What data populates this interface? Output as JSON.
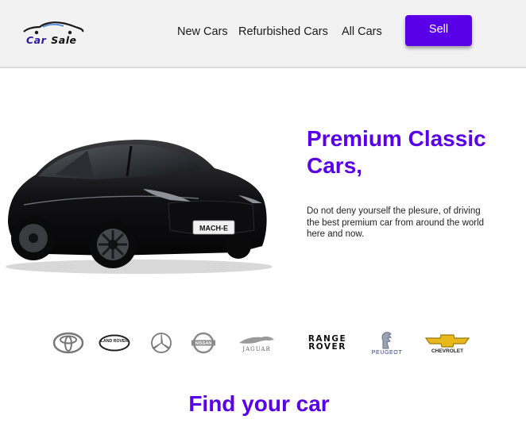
{
  "header": {
    "logo": {
      "word1": "Car",
      "word2": "Sale"
    },
    "nav": {
      "new_cars": "New Cars",
      "refurbished_cars": "Refurbished Cars",
      "all_cars": "All Cars"
    },
    "sell_label": "Sell"
  },
  "hero": {
    "title": "Premium Classic Cars,",
    "description": "Do not deny yourself the plesure, of driving the best premium car from around the world here and now.",
    "car_plate": "MACH-E"
  },
  "brands": {
    "land_rover": "LAND ROVER",
    "nissan": "NISSAN",
    "jaguar": "JAGUAR",
    "range_rover_line1": "RANGE",
    "range_rover_line2": "ROVER",
    "peugeot": "PEUGEOT",
    "chevrolet": "CHEVROLET"
  },
  "find_section": {
    "title": "Find your car"
  },
  "colors": {
    "accent": "#5a00e8",
    "header_bg": "#f2f2f2",
    "chevrolet_gold": "#e8b81c"
  },
  "icons": [
    "car-logo-icon",
    "toyota-logo-icon",
    "land-rover-logo-icon",
    "mercedes-logo-icon",
    "nissan-logo-icon",
    "jaguar-logo-icon",
    "range-rover-logo-icon",
    "peugeot-logo-icon",
    "chevrolet-logo-icon"
  ]
}
